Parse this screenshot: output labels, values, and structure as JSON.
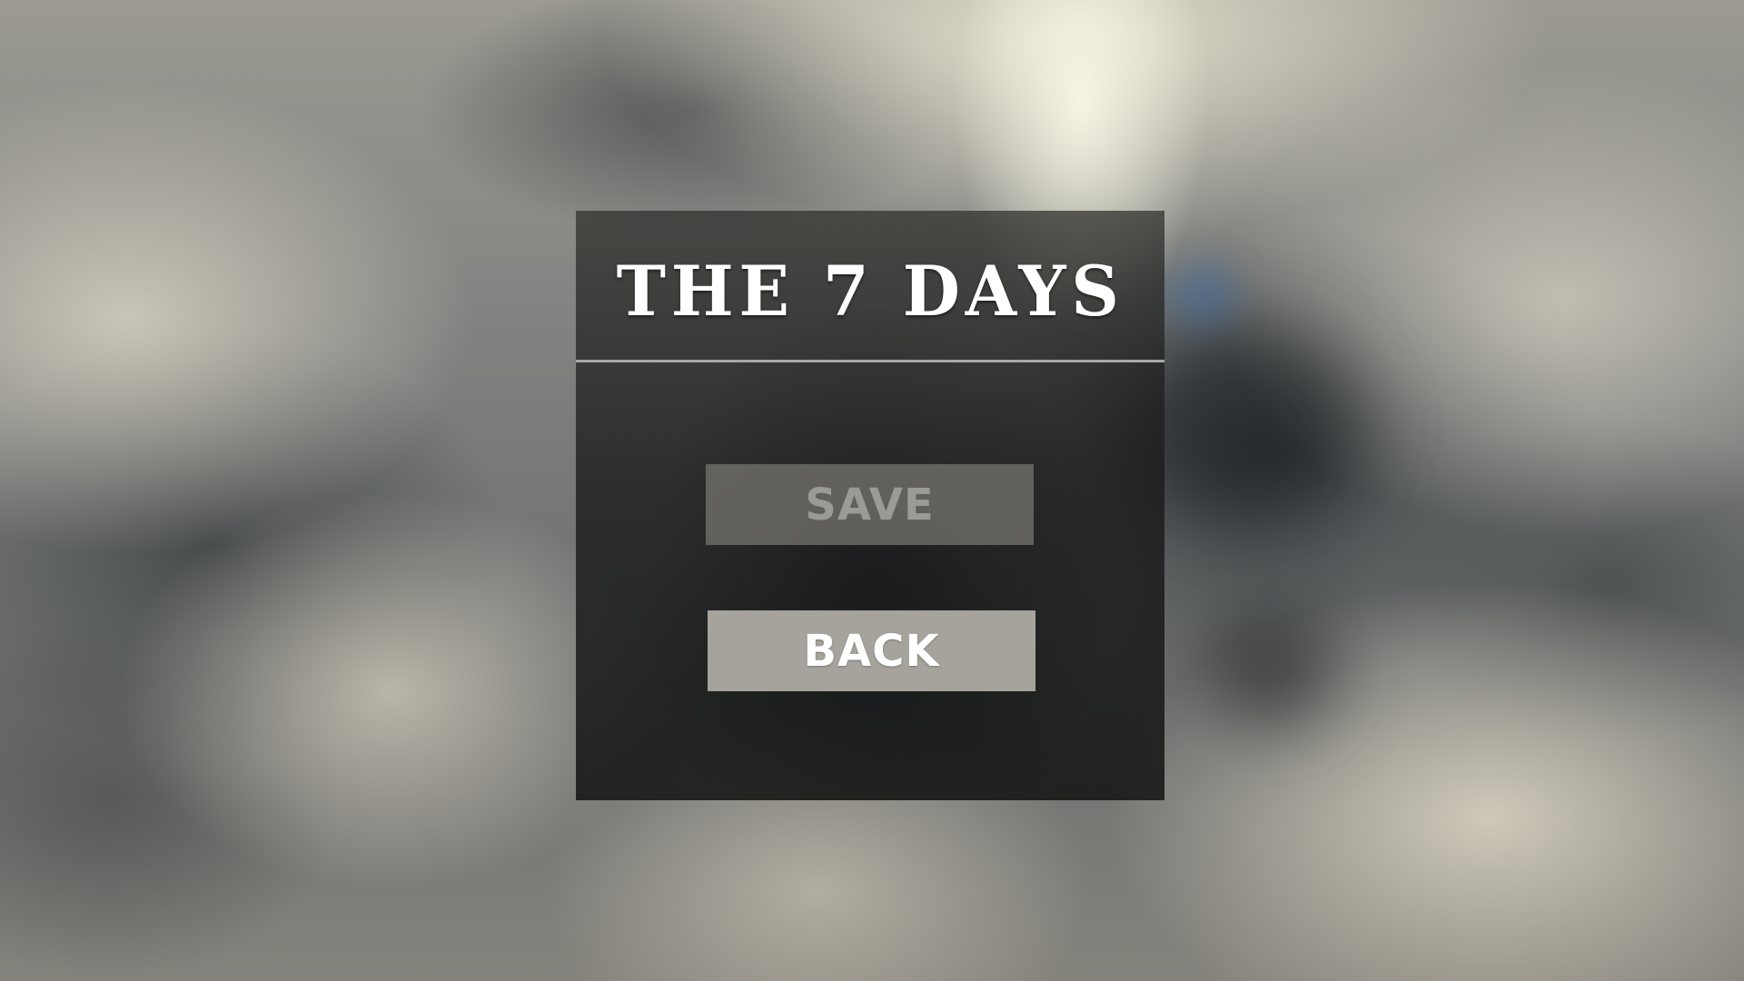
{
  "game": {
    "title": "THE 7 DAYS"
  },
  "menu": {
    "save_label": "SAVE",
    "back_label": "BACK",
    "save_enabled": false
  },
  "colors": {
    "panel": "#1e1f1f",
    "divider": "#a8a8a6",
    "save_button_bg": "#787772",
    "save_button_text": "#9a9a97",
    "back_button_bg": "#a5a39b",
    "back_button_text": "#ffffff"
  }
}
